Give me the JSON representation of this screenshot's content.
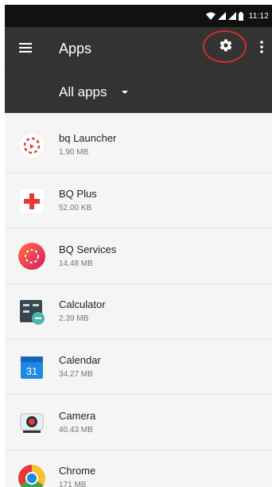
{
  "status_bar": {
    "time": "11:12",
    "icons": [
      "wifi-icon",
      "signal-icon",
      "signal-icon",
      "battery-icon"
    ]
  },
  "app_bar": {
    "menu_icon": "hamburger-menu-icon",
    "title": "Apps",
    "settings_icon": "gear-icon",
    "overflow_icon": "more-vertical-icon",
    "highlight_color": "#d62b2b"
  },
  "filter": {
    "selected": "All apps"
  },
  "apps": [
    {
      "name": "bq Launcher",
      "size": "1.90 MB",
      "icon": "bq-launcher-icon"
    },
    {
      "name": "BQ Plus",
      "size": "52.00 KB",
      "icon": "bq-plus-icon"
    },
    {
      "name": "BQ Services",
      "size": "14.48 MB",
      "icon": "bq-services-icon"
    },
    {
      "name": "Calculator",
      "size": "2.39 MB",
      "icon": "calculator-icon"
    },
    {
      "name": "Calendar",
      "size": "34.27 MB",
      "icon": "calendar-icon",
      "icon_text": "31"
    },
    {
      "name": "Camera",
      "size": "40.43 MB",
      "icon": "camera-icon"
    },
    {
      "name": "Chrome",
      "size": "171 MB",
      "icon": "chrome-icon"
    }
  ],
  "colors": {
    "status_bar": "#111111",
    "app_bar": "#333333",
    "list_background": "#f5f5f5",
    "primary_text": "#222222",
    "secondary_text": "#757575"
  }
}
